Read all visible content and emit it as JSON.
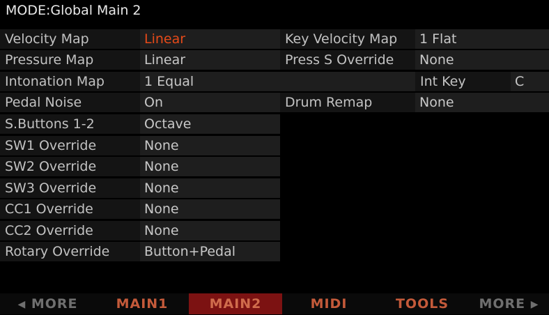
{
  "title": "MODE:Global Main 2",
  "params": {
    "velocity_map": {
      "label": "Velocity Map",
      "value": "Linear"
    },
    "pressure_map": {
      "label": "Pressure Map",
      "value": "Linear"
    },
    "intonation_map": {
      "label": "Intonation Map",
      "value": "1 Equal"
    },
    "pedal_noise": {
      "label": "Pedal Noise",
      "value": "On"
    },
    "sbuttons": {
      "label": "S.Buttons 1-2",
      "value": "Octave"
    },
    "sw1": {
      "label": "SW1 Override",
      "value": "None"
    },
    "sw2": {
      "label": "SW2 Override",
      "value": "None"
    },
    "sw3": {
      "label": "SW3 Override",
      "value": "None"
    },
    "cc1": {
      "label": "CC1 Override",
      "value": "None"
    },
    "cc2": {
      "label": "CC2 Override",
      "value": "None"
    },
    "rotary": {
      "label": "Rotary Override",
      "value": "Button+Pedal"
    },
    "key_velocity_map": {
      "label": "Key Velocity Map",
      "value": "1 Flat"
    },
    "press_s_override": {
      "label": "Press S Override",
      "value": "None"
    },
    "int_key": {
      "label": "Int Key",
      "value": "C"
    },
    "drum_remap": {
      "label": "Drum Remap",
      "value": "None"
    }
  },
  "tabs": {
    "more_left": {
      "arrow": "◀",
      "label": "MORE"
    },
    "main1": "MAIN1",
    "main2": "MAIN2",
    "midi": "MIDI",
    "tools": "TOOLS",
    "more_right": {
      "label": "MORE",
      "arrow": "▶"
    }
  },
  "colors": {
    "selected_value": "#e64a19",
    "tab_text": "#c45a3a",
    "selected_tab_bg": "#7c1212"
  }
}
